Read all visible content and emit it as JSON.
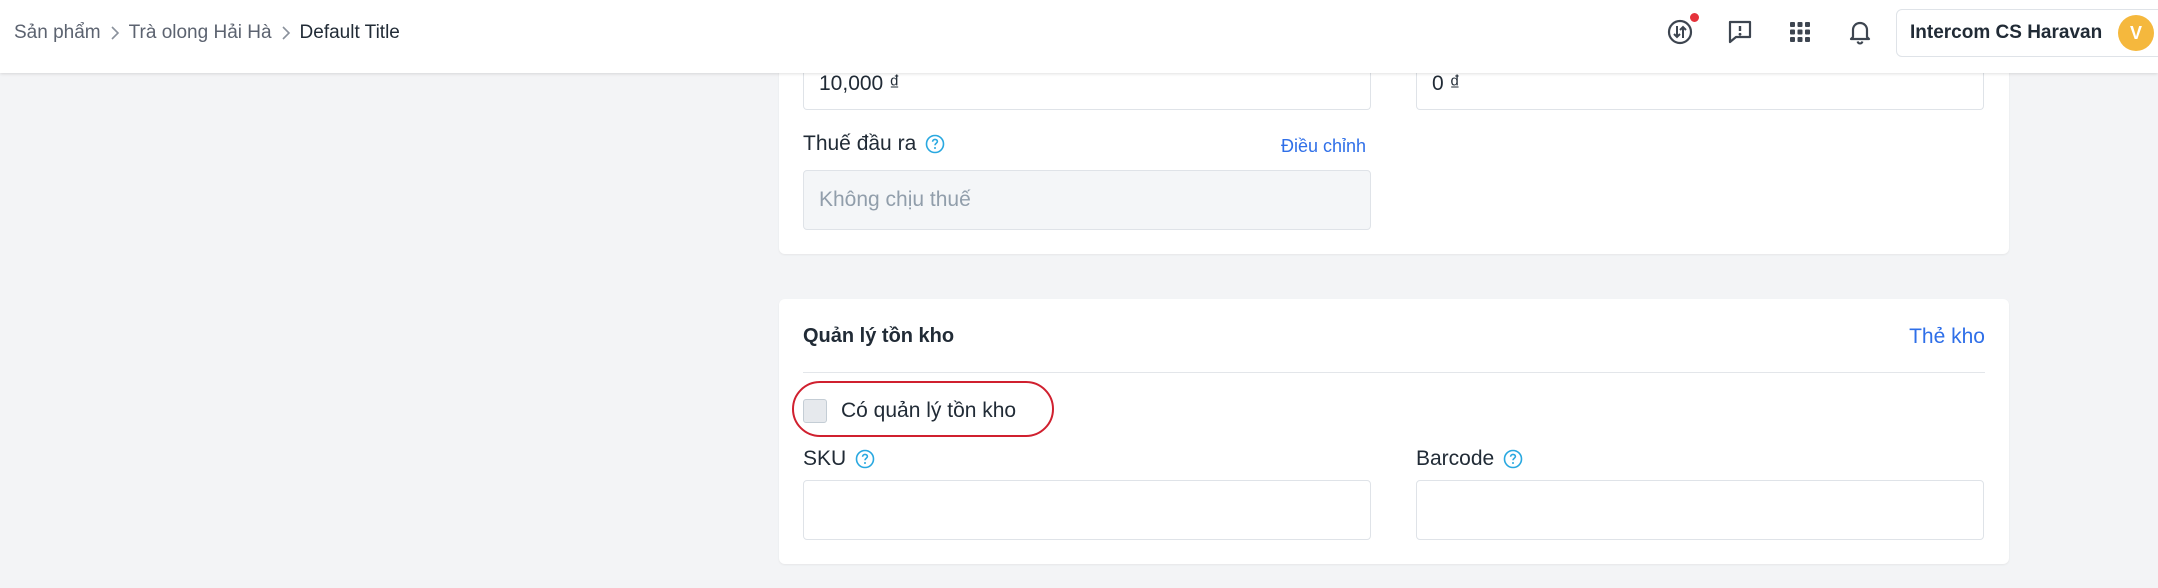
{
  "breadcrumb": {
    "items": [
      "Sản phẩm",
      "Trà olong Hải Hà"
    ],
    "current": "Default Title"
  },
  "topbar": {
    "icons": [
      "transfer-icon",
      "feedback-icon",
      "apps-grid-icon",
      "bell-icon"
    ],
    "notification_dot_color": "#e5323b",
    "account_name": "Intercom CS Haravan",
    "avatar_letter": "V",
    "avatar_color": "#f5b83d"
  },
  "pricing": {
    "price_value": "10,000 ₫",
    "compare_value": "0 ₫",
    "tax_label": "Thuế đầu ra",
    "tax_adjust_link": "Điều chỉnh",
    "tax_value": "Không chịu thuế"
  },
  "inventory": {
    "title": "Quản lý tồn kho",
    "stock_card_link": "Thẻ kho",
    "manage_checkbox_label": "Có quản lý tồn kho",
    "manage_checked": false,
    "sku_label": "SKU",
    "sku_value": "",
    "barcode_label": "Barcode",
    "barcode_value": ""
  },
  "colors": {
    "accent_link": "#2f6fe8",
    "help_icon": "#29a8e0",
    "highlight_ring": "#d0202f"
  }
}
